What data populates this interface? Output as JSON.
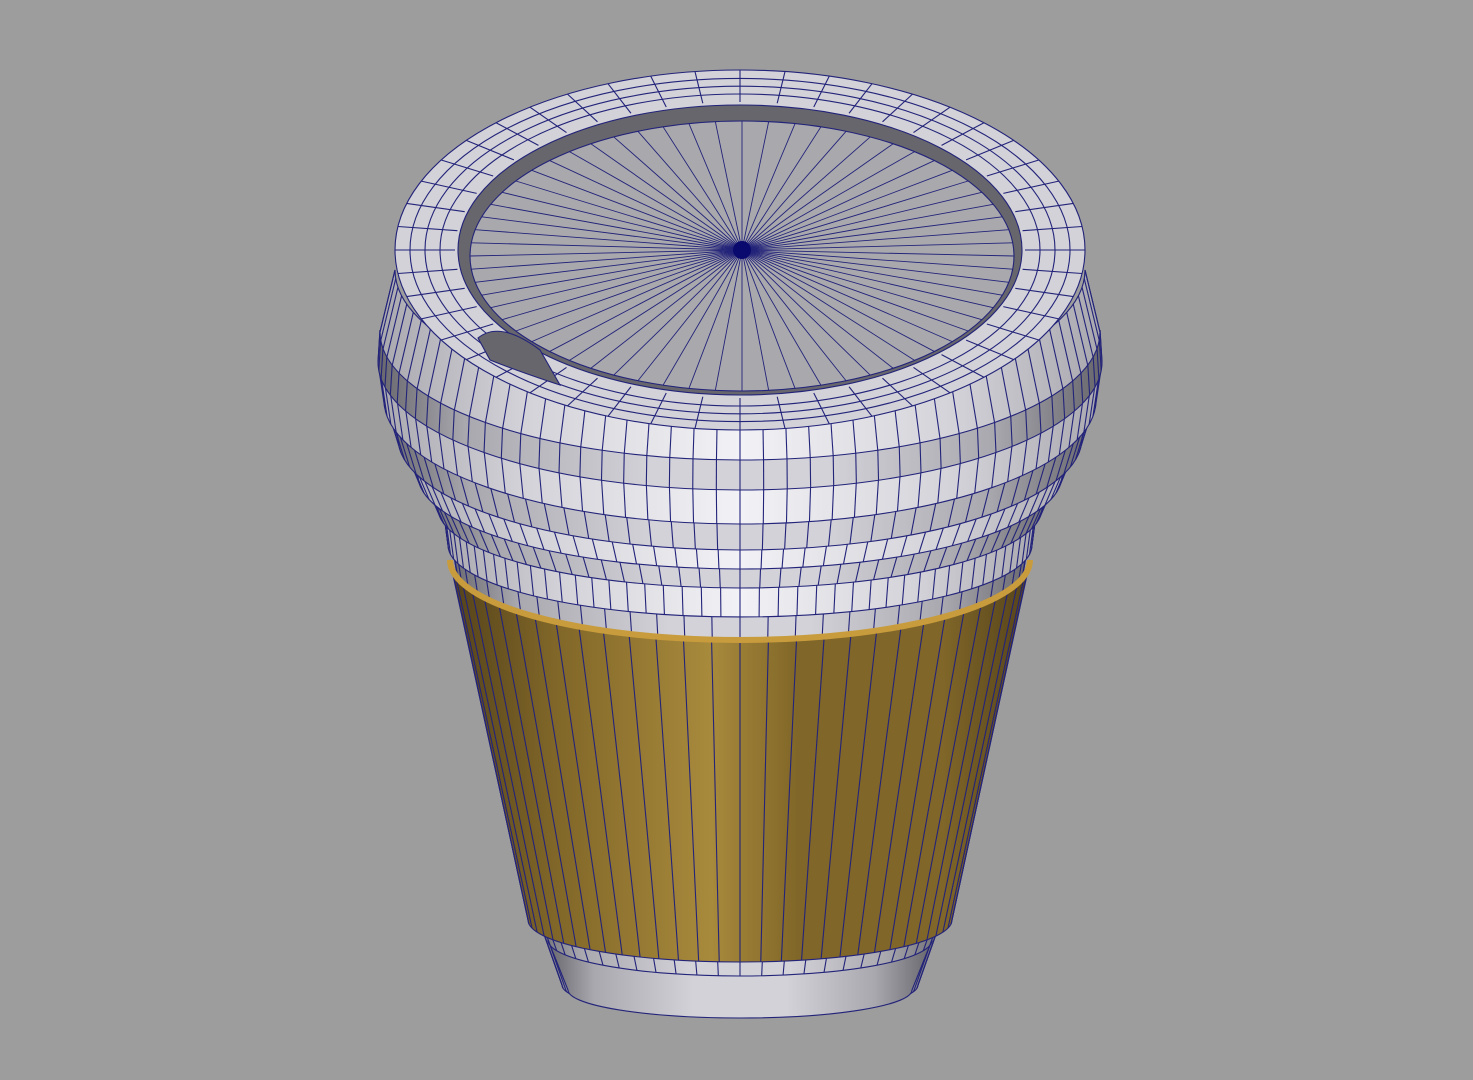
{
  "viewport": {
    "background": "#9d9d9d"
  },
  "model": {
    "subject": "coffee-cup-mesh",
    "render_mode": "wireframe-on-shaded",
    "colors": {
      "shell_light": "#d2d2d8",
      "shell_mid": "#a8a8ae",
      "shell_dark": "#66666c",
      "highlight": "#f2f2f6",
      "sleeve_light": "#a88a3c",
      "sleeve_mid": "#806628",
      "sleeve_dark": "#54421a",
      "sleeve_rim": "#c89c3c",
      "wire": "#23237a",
      "pole": "#0a0a6e"
    }
  }
}
